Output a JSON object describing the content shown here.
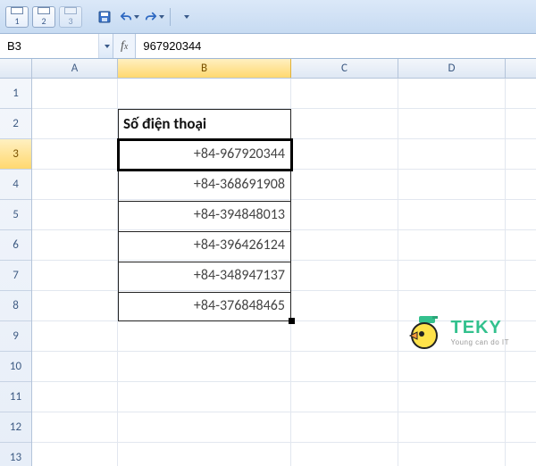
{
  "toolbar": {
    "view_buttons": [
      "1",
      "2",
      "3"
    ]
  },
  "namebox": "B3",
  "formula": "967920344",
  "columns": [
    "A",
    "B",
    "C",
    "D"
  ],
  "rows": [
    "1",
    "2",
    "3",
    "4",
    "5",
    "6",
    "7",
    "8",
    "9",
    "10",
    "11",
    "12",
    "13"
  ],
  "active_cell": "B3",
  "selected_col": "B",
  "selected_row": "3",
  "table": {
    "header": "Số điện thoại",
    "values": [
      "+84-967920344",
      "+84-368691908",
      "+84-394848013",
      "+84-396426124",
      "+84-348947137",
      "+84-376848465"
    ]
  },
  "logo": {
    "name": "TEKY",
    "tagline": "Young can do IT"
  }
}
